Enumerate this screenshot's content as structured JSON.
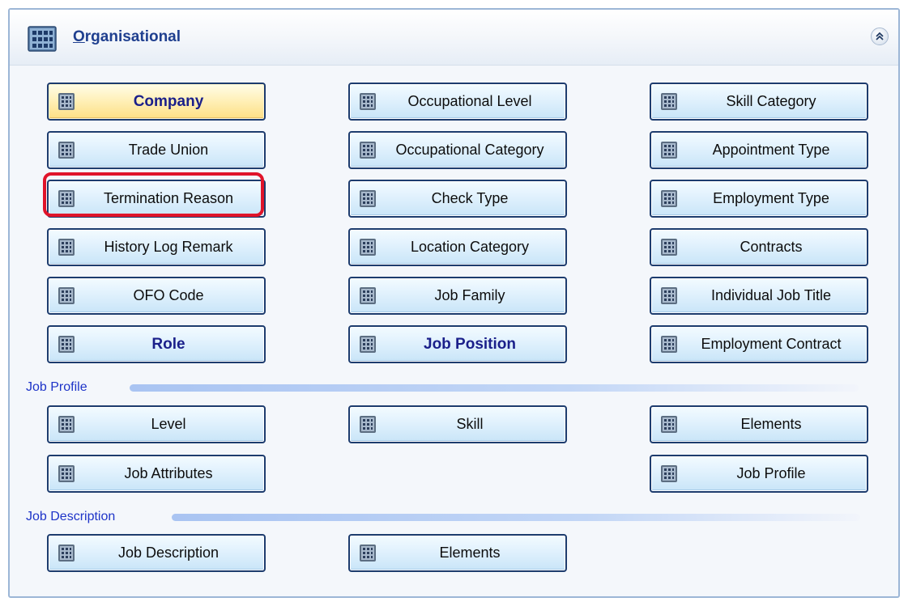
{
  "panel": {
    "title_underlined_letter": "O",
    "title_rest": "rganisational",
    "icon": "building-icon",
    "collapse_icon": "double-chevron-up-icon"
  },
  "buttons": {
    "company": "Company",
    "occupational_level": "Occupational Level",
    "skill_category": "Skill Category",
    "trade_union": "Trade Union",
    "occupational_category": "Occupational Category",
    "appointment_type": "Appointment Type",
    "termination_reason": "Termination Reason",
    "check_type": "Check Type",
    "employment_type": "Employment Type",
    "history_log_remark": "History Log Remark",
    "location_category": "Location Category",
    "contracts": "Contracts",
    "ofo_code": "OFO Code",
    "job_family": "Job Family",
    "individual_job_title": "Individual Job Title",
    "role": "Role",
    "job_position": "Job Position",
    "employment_contract": "Employment Contract",
    "level": "Level",
    "skill": "Skill",
    "elements_profile": "Elements",
    "job_attributes": "Job Attributes",
    "job_profile": "Job Profile",
    "job_description": "Job Description",
    "elements_description": "Elements"
  },
  "sections": {
    "job_profile": "Job Profile",
    "job_description": "Job Description"
  },
  "colors": {
    "accent_title": "#1f3f8f",
    "section_text": "#1e34c8",
    "highlight": "#e0142a",
    "active_button": "#fddf84"
  }
}
